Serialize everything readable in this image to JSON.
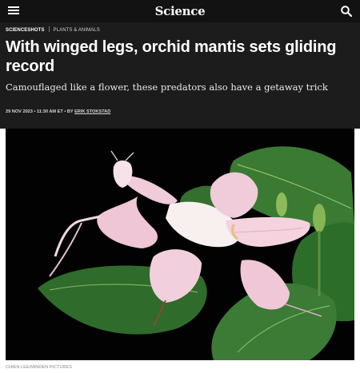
{
  "header": {
    "logo": "Science",
    "menu_icon": "hamburger-menu-icon",
    "search_icon": "search-icon",
    "background": "#121212"
  },
  "article": {
    "section": "SCIENCESHOTS",
    "subsection": "PLANTS & ANIMALS",
    "headline": "With winged legs, orchid mantis sets gliding record",
    "dek": "Camouflaged like a flower, these predators also have a getaway trick",
    "date": "29 NOV 2023",
    "time": "11:30 AM ET",
    "by": "BY",
    "author": "ERIK STOKSTAD",
    "background": "#1c1c1c"
  },
  "image": {
    "credit": "CHIEN LEE/MINDEN PICTURES"
  }
}
